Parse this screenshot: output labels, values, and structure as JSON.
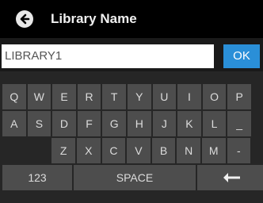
{
  "header": {
    "title": "Library Name",
    "back_icon": "back-arrow-circle-icon"
  },
  "input": {
    "value": "LIBRARY1",
    "ok_label": "OK"
  },
  "keyboard": {
    "row1": [
      "Q",
      "W",
      "E",
      "R",
      "T",
      "Y",
      "U",
      "I",
      "O",
      "P"
    ],
    "row2": [
      "A",
      "S",
      "D",
      "F",
      "G",
      "H",
      "J",
      "K",
      "L",
      "_"
    ],
    "row3": [
      "Z",
      "X",
      "C",
      "V",
      "B",
      "N",
      "M",
      "-"
    ],
    "num_label": "123",
    "space_label": "SPACE",
    "backspace_icon": "backspace-arrow-icon"
  },
  "colors": {
    "accent": "#2a8fd8",
    "key": "#4d4d4d",
    "header": "#000000"
  }
}
